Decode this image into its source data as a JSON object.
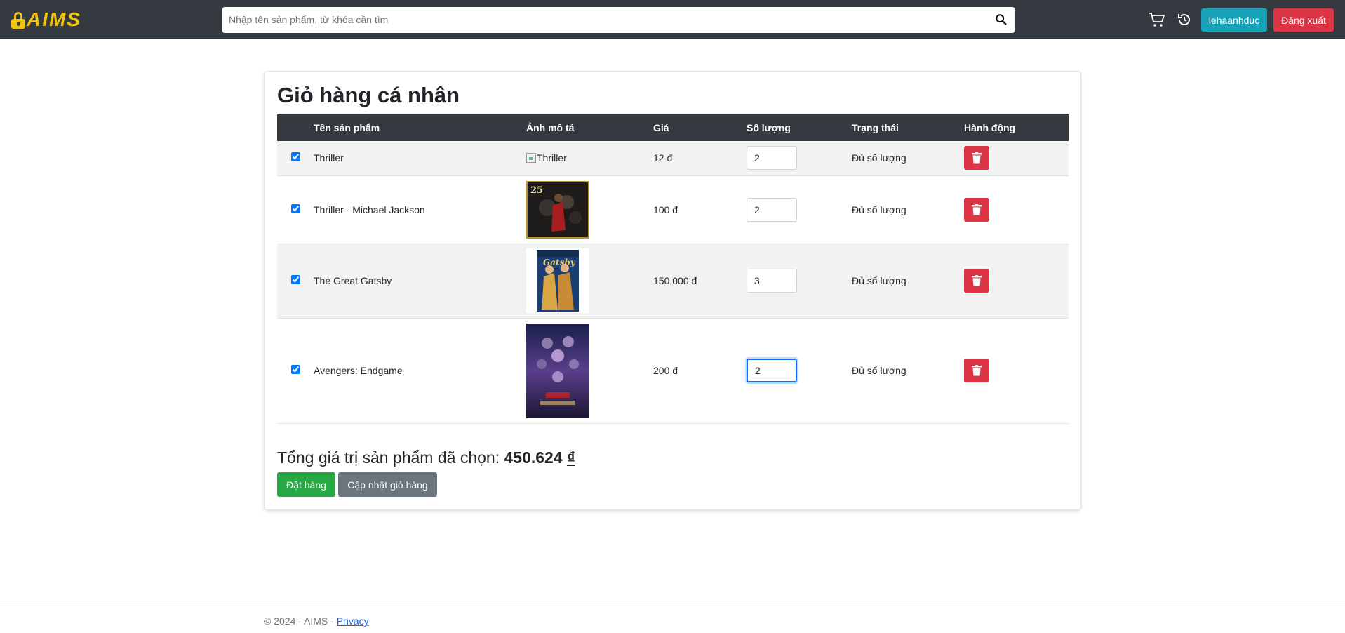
{
  "header": {
    "logo_text": "AIMS",
    "search_placeholder": "Nhập tên sản phẩm, từ khóa cần tìm",
    "user_button": "lehaanhduc",
    "logout_button": "Đăng xuất",
    "icons": [
      "cart-icon",
      "history-icon",
      "search-icon"
    ]
  },
  "cart": {
    "title": "Giỏ hàng cá nhân",
    "columns": [
      "",
      "Tên sản phẩm",
      "Ảnh mô tả",
      "Giá",
      "Số lượng",
      "Trạng thái",
      "Hành động"
    ],
    "items": [
      {
        "checked": true,
        "name": "Thriller",
        "image_alt": "Thriller",
        "price": "12 đ",
        "quantity": "2",
        "status": "Đủ số lượng"
      },
      {
        "checked": true,
        "name": "Thriller - Michael Jackson",
        "image_alt": "Thriller - Michael Jackson",
        "price": "100 đ",
        "quantity": "2",
        "status": "Đủ số lượng"
      },
      {
        "checked": true,
        "name": "The Great Gatsby",
        "image_alt": "The Great Gatsby",
        "price": "150,000 đ",
        "quantity": "3",
        "status": "Đủ số lượng"
      },
      {
        "checked": true,
        "name": "Avengers: Endgame",
        "image_alt": "Avengers: Endgame",
        "price": "200 đ",
        "quantity": "2",
        "status": "Đủ số lượng"
      }
    ],
    "total_label": "Tổng giá trị sản phẩm đã chọn:",
    "total_value": "450.624",
    "total_currency": "₫",
    "order_button": "Đặt hàng",
    "update_button": "Cập nhật giỏ hàng"
  },
  "footer": {
    "text": "© 2024 - AIMS -",
    "privacy_link": "Privacy"
  },
  "colors": {
    "navbar": "#343a40",
    "logo": "#f1c40f",
    "info": "#17a2b8",
    "danger": "#dc3545",
    "success": "#28a745",
    "secondary": "#6c757d"
  }
}
